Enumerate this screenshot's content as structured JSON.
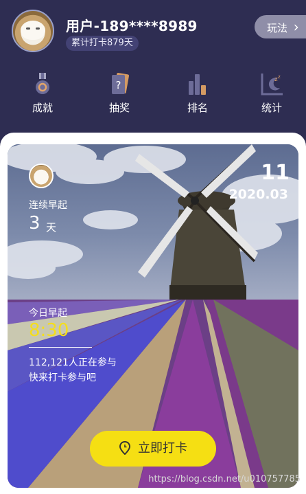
{
  "header": {
    "username": "用户-189****8989",
    "checkin_badge": "累计打卡879天",
    "play_label": "玩法",
    "play_chevron": "›"
  },
  "nav": [
    {
      "label": "成就",
      "icon": "medal-icon"
    },
    {
      "label": "抽奖",
      "icon": "lottery-card-icon"
    },
    {
      "label": "排名",
      "icon": "ranking-bars-icon"
    },
    {
      "label": "统计",
      "icon": "statistics-sleep-icon"
    }
  ],
  "card": {
    "day": "11",
    "year_month": "2020.03",
    "streak_label": "连续早起",
    "streak_value": "3",
    "streak_unit": "天",
    "today_label": "今日早起",
    "today_time": "8:30",
    "participants": "112,121人正在参与",
    "join_text": "快来打卡参与吧"
  },
  "checkin_button": {
    "label": "立即打卡",
    "icon": "location-pin-icon"
  },
  "watermark": "https://blog.csdn.net/u010757785",
  "colors": {
    "header_bg": "#2e2d52",
    "badge_bg": "#434274",
    "accent_yellow": "#f5df13",
    "time_yellow": "#f5de1b"
  }
}
